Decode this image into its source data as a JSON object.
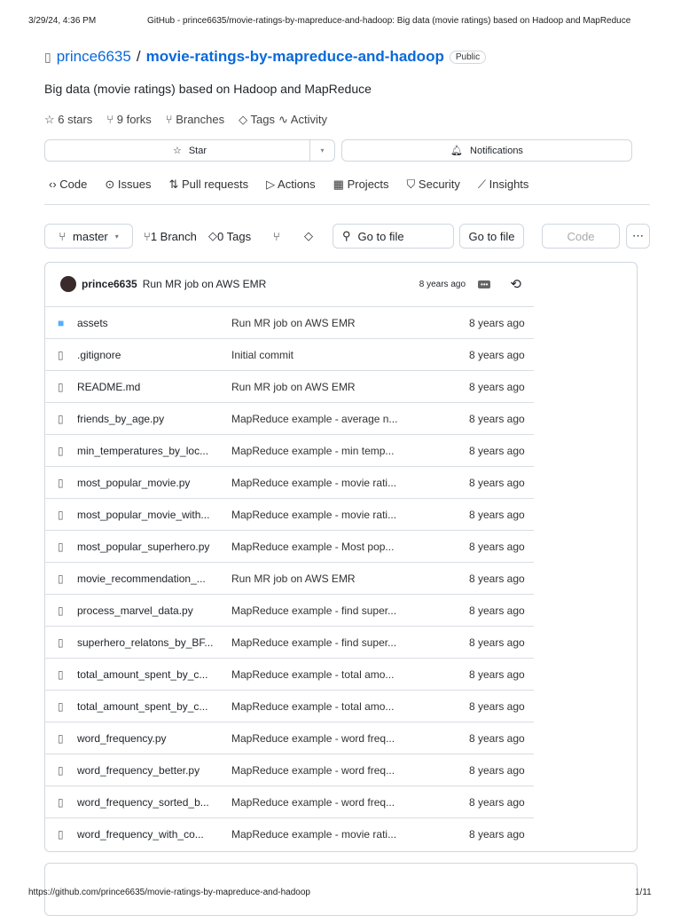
{
  "print_header": {
    "datetime": "3/29/24, 4:36 PM",
    "title": "GitHub - prince6635/movie-ratings-by-mapreduce-and-hadoop: Big data (movie ratings) based on Hadoop and MapReduce"
  },
  "repo": {
    "owner": "prince6635",
    "name": "movie-ratings-by-mapreduce-and-hadoop",
    "visibility": "Public",
    "description": "Big data (movie ratings) based on Hadoop and MapReduce"
  },
  "stats": {
    "stars": "6 stars",
    "forks": "9 forks",
    "branches": "Branches",
    "tags": "Tags",
    "activity": "Activity"
  },
  "actions": {
    "star": "Star",
    "notifications": "Notifications"
  },
  "nav": [
    "Code",
    "Issues",
    "Pull requests",
    "Actions",
    "Projects",
    "Security",
    "Insights"
  ],
  "toolbar": {
    "branch": "master",
    "branch_count": "1 Branch",
    "tag_count": "0 Tags",
    "search_placeholder": "Go to file",
    "goto": "Go to file",
    "code": "Code"
  },
  "latest_commit": {
    "author": "prince6635",
    "message": "Run MR job on AWS EMR",
    "age": "8 years ago"
  },
  "files": [
    {
      "type": "folder",
      "name": "assets",
      "message": "Run MR job on AWS EMR",
      "age": "8 years ago"
    },
    {
      "type": "file",
      "name": ".gitignore",
      "message": "Initial commit",
      "age": "8 years ago"
    },
    {
      "type": "file",
      "name": "README.md",
      "message": "Run MR job on AWS EMR",
      "age": "8 years ago"
    },
    {
      "type": "file",
      "name": "friends_by_age.py",
      "message": "MapReduce example - average n...",
      "age": "8 years ago"
    },
    {
      "type": "file",
      "name": "min_temperatures_by_loc...",
      "message": "MapReduce example - min temp...",
      "age": "8 years ago"
    },
    {
      "type": "file",
      "name": "most_popular_movie.py",
      "message": "MapReduce example - movie rati...",
      "age": "8 years ago"
    },
    {
      "type": "file",
      "name": "most_popular_movie_with...",
      "message": "MapReduce example - movie rati...",
      "age": "8 years ago"
    },
    {
      "type": "file",
      "name": "most_popular_superhero.py",
      "message": "MapReduce example - Most pop...",
      "age": "8 years ago"
    },
    {
      "type": "file",
      "name": "movie_recommendation_...",
      "message": "Run MR job on AWS EMR",
      "age": "8 years ago"
    },
    {
      "type": "file",
      "name": "process_marvel_data.py",
      "message": "MapReduce example - find super...",
      "age": "8 years ago"
    },
    {
      "type": "file",
      "name": "superhero_relatons_by_BF...",
      "message": "MapReduce example - find super...",
      "age": "8 years ago"
    },
    {
      "type": "file",
      "name": "total_amount_spent_by_c...",
      "message": "MapReduce example - total amo...",
      "age": "8 years ago"
    },
    {
      "type": "file",
      "name": "total_amount_spent_by_c...",
      "message": "MapReduce example - total amo...",
      "age": "8 years ago"
    },
    {
      "type": "file",
      "name": "word_frequency.py",
      "message": "MapReduce example - word freq...",
      "age": "8 years ago"
    },
    {
      "type": "file",
      "name": "word_frequency_better.py",
      "message": "MapReduce example - word freq...",
      "age": "8 years ago"
    },
    {
      "type": "file",
      "name": "word_frequency_sorted_b...",
      "message": "MapReduce example - word freq...",
      "age": "8 years ago"
    },
    {
      "type": "file",
      "name": "word_frequency_with_co...",
      "message": "MapReduce example - movie rati...",
      "age": "8 years ago"
    }
  ],
  "print_footer": {
    "url": "https://github.com/prince6635/movie-ratings-by-mapreduce-and-hadoop",
    "page": "1/11"
  }
}
